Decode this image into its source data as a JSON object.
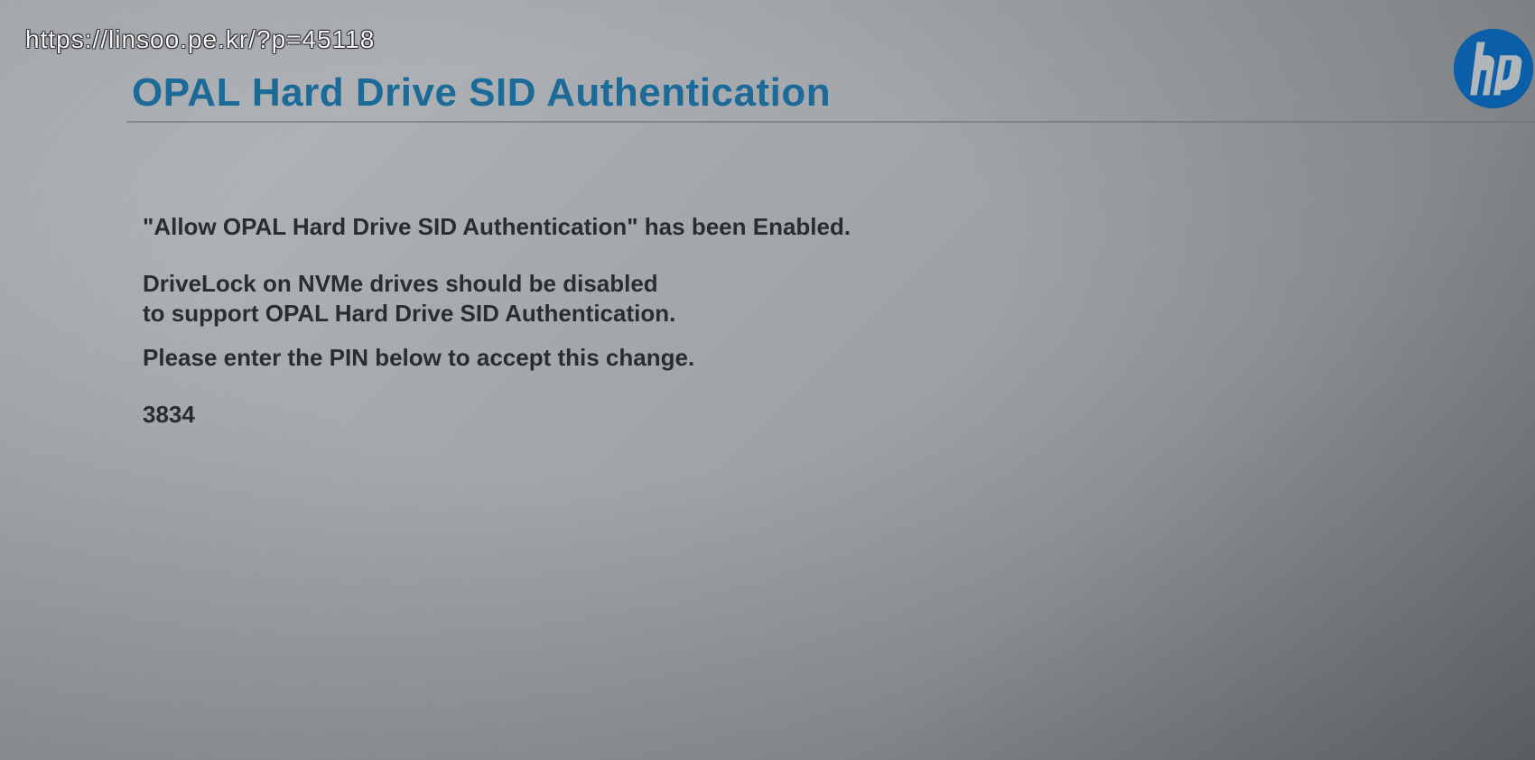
{
  "overlay_url": "https://linsoo.pe.kr/?p=45118",
  "title": "OPAL Hard Drive SID Authentication",
  "messages": {
    "line1": "\"Allow OPAL Hard Drive SID Authentication\" has been Enabled.",
    "line2a": "DriveLock on NVMe drives should be disabled",
    "line2b": "to support OPAL Hard Drive SID Authentication.",
    "line3": "Please enter the PIN below to accept this change."
  },
  "pin": "3834",
  "brand": "hp",
  "colors": {
    "accent": "#1b6a98",
    "logo": "#0b5ea8"
  }
}
